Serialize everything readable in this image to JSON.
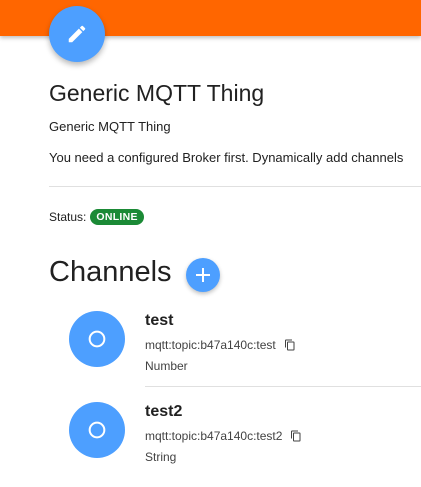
{
  "thing": {
    "title": "Generic MQTT Thing",
    "subtitle": "Generic MQTT Thing",
    "message": "You need a configured Broker first. Dynamically add channels"
  },
  "status": {
    "label": "Status:",
    "value": "ONLINE"
  },
  "channels": {
    "heading": "Channels",
    "items": [
      {
        "name": "test",
        "uid": "mqtt:topic:b47a140c:test",
        "type": "Number"
      },
      {
        "name": "test2",
        "uid": "mqtt:topic:b47a140c:test2",
        "type": "String"
      }
    ]
  },
  "icons": {
    "edit": "pencil-icon",
    "add": "plus-icon",
    "channel": "circle-outline-icon",
    "copy": "copy-icon"
  },
  "colors": {
    "top_bar": "#ff6600",
    "accent": "#4d9fff",
    "online": "#1b8a36"
  }
}
